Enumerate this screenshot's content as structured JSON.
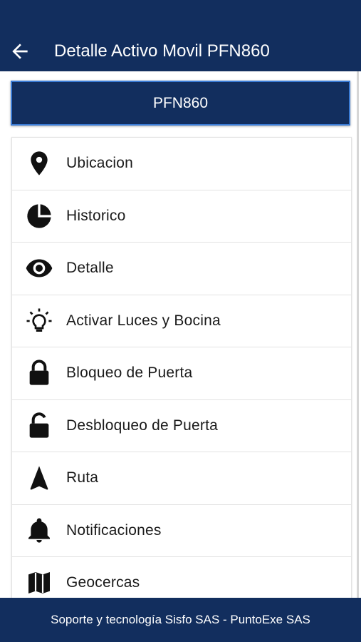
{
  "header": {
    "title": "Detalle Activo Movil PFN860",
    "back_icon": "arrow-left-icon"
  },
  "plate_button": {
    "label": "PFN860"
  },
  "menu": {
    "items": [
      {
        "label": "Ubicacion",
        "icon": "location-pin-icon"
      },
      {
        "label": "Historico",
        "icon": "pie-chart-icon"
      },
      {
        "label": "Detalle",
        "icon": "eye-icon"
      },
      {
        "label": "Activar Luces y Bocina",
        "icon": "lightbulb-icon"
      },
      {
        "label": "Bloqueo de Puerta",
        "icon": "lock-icon"
      },
      {
        "label": "Desbloqueo de Puerta",
        "icon": "unlock-icon"
      },
      {
        "label": "Ruta",
        "icon": "navigation-arrow-icon"
      },
      {
        "label": "Notificaciones",
        "icon": "bell-icon"
      },
      {
        "label": "Geocercas",
        "icon": "map-icon"
      }
    ]
  },
  "footer": {
    "text": "Soporte y tecnología Sisfo SAS - PuntoExe SAS"
  },
  "colors": {
    "primary": "#122e5e",
    "plate_border": "#3a7bd5",
    "text": "#1a1a1a"
  }
}
